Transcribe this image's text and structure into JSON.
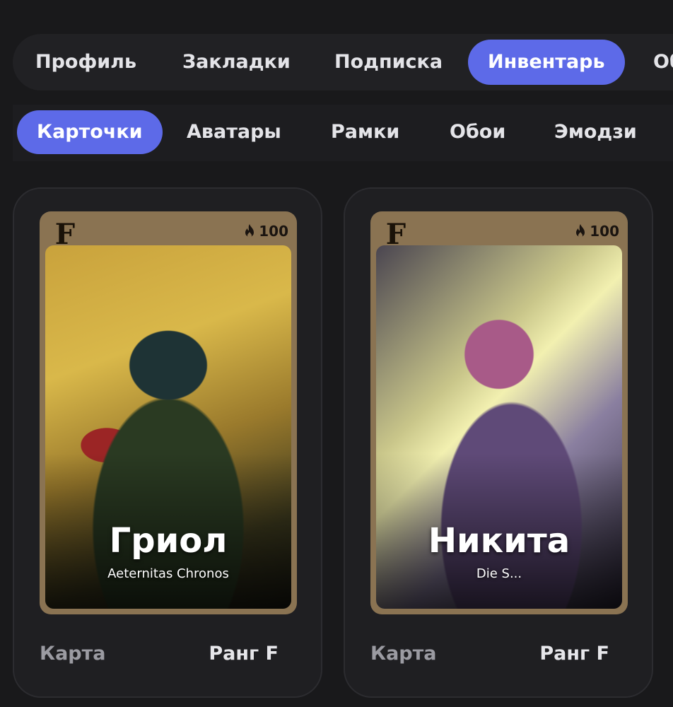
{
  "tabs": [
    {
      "label": "Профиль",
      "active": false
    },
    {
      "label": "Закладки",
      "active": false
    },
    {
      "label": "Подписка",
      "active": false
    },
    {
      "label": "Инвентарь",
      "active": true
    },
    {
      "label": "Об",
      "active": false
    }
  ],
  "subtabs": [
    {
      "label": "Карточки",
      "active": true
    },
    {
      "label": "Аватары",
      "active": false
    },
    {
      "label": "Рамки",
      "active": false
    },
    {
      "label": "Обои",
      "active": false
    },
    {
      "label": "Эмодзи",
      "active": false
    }
  ],
  "cards": [
    {
      "name": "Гриол",
      "subtitle": "Aeternitas Chronos",
      "fire_count": "100",
      "rank_logo": "F",
      "type_label": "Карта",
      "rank_label": "Ранг F",
      "icon": "fire-icon"
    },
    {
      "name": "Никита",
      "subtitle": "Die S...",
      "fire_count": "100",
      "rank_logo": "F",
      "type_label": "Карта",
      "rank_label": "Ранг F",
      "icon": "fire-icon"
    }
  ],
  "colors": {
    "accent": "#5d6ae8",
    "background": "#19191b",
    "card_frame": "#8a7352"
  }
}
